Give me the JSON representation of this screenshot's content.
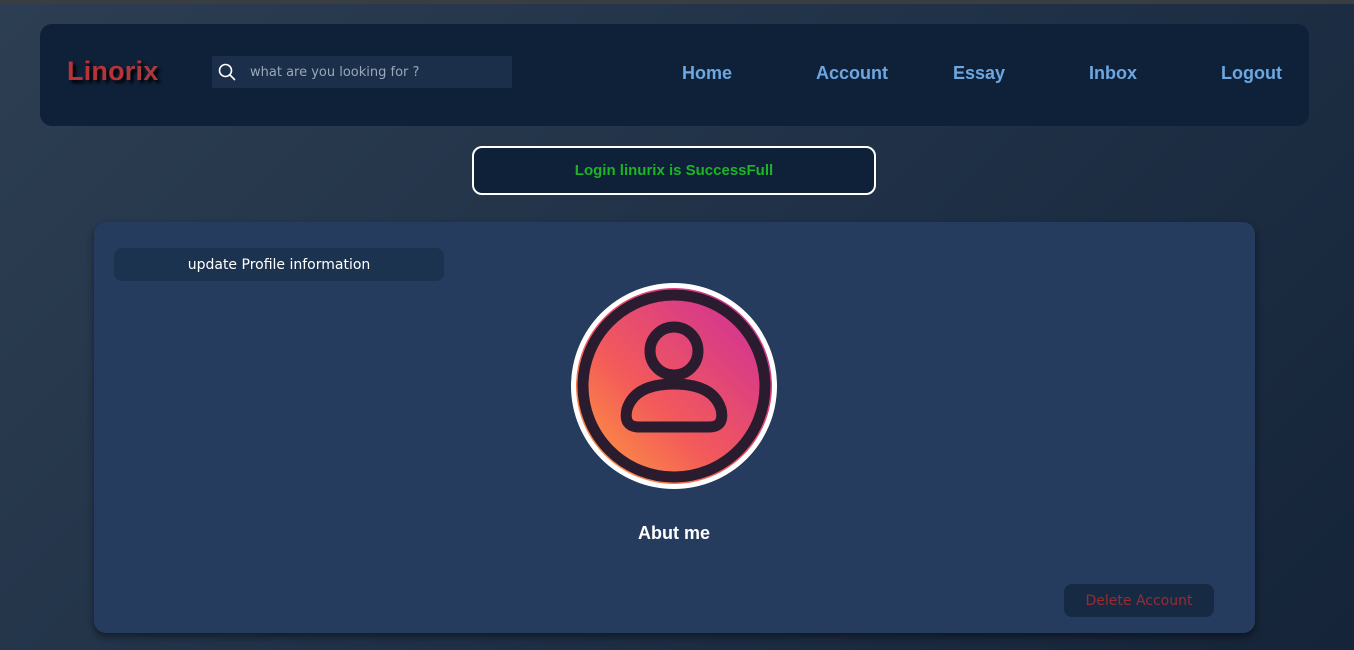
{
  "header": {
    "logo_prefix": "Lino",
    "logo_suffix": "rix",
    "search_placeholder": "what are you looking for ?",
    "nav": {
      "home": "Home",
      "account": "Account",
      "essay": "Essay",
      "inbox": "Inbox",
      "logout": "Logout"
    }
  },
  "alert": {
    "message": "Login linurix is SuccessFull",
    "color": "#1bb526"
  },
  "profile": {
    "update_label": "update Profile information",
    "about_label": "Abut me",
    "delete_label": "Delete Account",
    "avatar_icon": "user-avatar-icon"
  },
  "colors": {
    "background": "#253c5e",
    "navbar": "#0f2139",
    "nav_link": "#6ea7e0",
    "logo": "#b8323a",
    "delete_text": "#9a2a34"
  }
}
